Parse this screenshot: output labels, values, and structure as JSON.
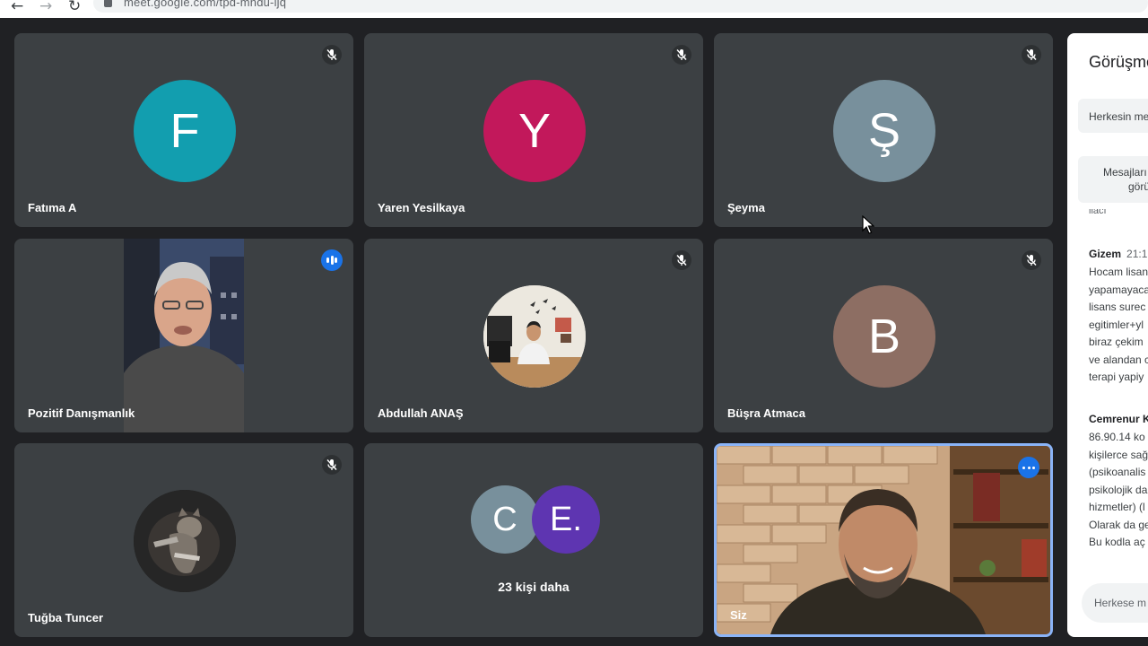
{
  "browser": {
    "url": "meet.google.com/tpd-mhdu-ijq",
    "back_icon": "←",
    "forward_icon": "→",
    "reload_icon": "↻"
  },
  "tiles": [
    {
      "name": "Fatıma A",
      "initial": "F",
      "color": "#129eaf",
      "mic": "muted"
    },
    {
      "name": "Yaren Yesilkaya",
      "initial": "Y",
      "color": "#c2185b",
      "mic": "muted"
    },
    {
      "name": "Şeyma",
      "initial": "Ş",
      "color": "#78909c",
      "mic": "muted"
    },
    {
      "name": "Pozitif Danışmanlık",
      "mic": "speaking"
    },
    {
      "name": "Abdullah ANAŞ",
      "mic": "muted"
    },
    {
      "name": "Büşra Atmaca",
      "initial": "B",
      "color": "#8d6e63",
      "mic": "muted"
    },
    {
      "name": "Tuğba Tuncer",
      "mic": "muted"
    },
    {
      "more": {
        "avatar1": "C",
        "avatar1_color": "#78909c",
        "avatar2": "E.",
        "avatar2_color": "#5e35b1",
        "label": "23 kişi daha"
      }
    },
    {
      "name": "Siz",
      "self": true
    }
  ],
  "chat": {
    "title": "Görüşme",
    "chip1": "Herkesin me",
    "chip2_line1": "Mesajları",
    "chip2_line2": "görü",
    "cut_text": "ilacı",
    "messages": [
      {
        "sender": "Gizem",
        "time": "21:1",
        "lines": [
          "Hocam lisan",
          "yapamayaca",
          "lisans surec",
          "egitimler+yl",
          "biraz çekim",
          "ve alandan c",
          "terapi yapiy"
        ]
      },
      {
        "sender": "Cemrenur K",
        "time": "",
        "lines": [
          "86.90.14 ko",
          "kişilerce sağ",
          "(psikoanalis",
          "psikolojik da",
          "hizmetler) (l",
          "Olarak da ge",
          "Bu kodla aç"
        ]
      }
    ],
    "input_placeholder": "Herkese m"
  }
}
